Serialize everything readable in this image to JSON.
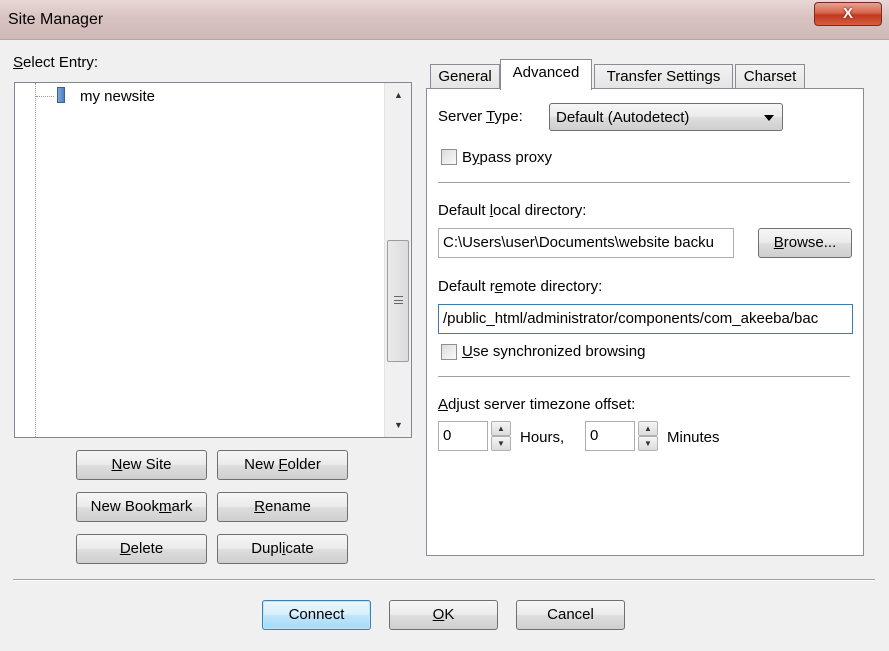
{
  "window": {
    "title": "Site Manager",
    "close_glyph": "X"
  },
  "left": {
    "select_entry_prefix": "S",
    "select_entry_rest": "elect Entry:",
    "tree_items": [
      {
        "label": "my newsite",
        "icon": "server-icon"
      }
    ]
  },
  "entry_buttons": {
    "new_site_pre": "",
    "new_site_u": "N",
    "new_site_post": "ew Site",
    "new_folder_pre": "New ",
    "new_folder_u": "F",
    "new_folder_post": "older",
    "new_bookmark_pre": "New Book",
    "new_bookmark_u": "m",
    "new_bookmark_post": "ark",
    "rename_pre": "",
    "rename_u": "R",
    "rename_post": "ename",
    "delete_pre": "",
    "delete_u": "D",
    "delete_post": "elete",
    "duplicate_pre": "Dupl",
    "duplicate_u": "i",
    "duplicate_post": "cate"
  },
  "tabs": [
    {
      "label": "General"
    },
    {
      "label": "Advanced",
      "active": true
    },
    {
      "label": "Transfer Settings"
    },
    {
      "label": "Charset"
    }
  ],
  "advanced": {
    "server_type_pre": "Server ",
    "server_type_u": "T",
    "server_type_post": "ype:",
    "server_type_value": "Default (Autodetect)",
    "bypass_pre": "B",
    "bypass_u": "y",
    "bypass_post": "pass proxy",
    "bypass_checked": false,
    "local_dir_pre": "Default ",
    "local_dir_u": "l",
    "local_dir_post": "ocal directory:",
    "local_dir_value": "C:\\Users\\user\\Documents\\website backu",
    "browse_u": "B",
    "browse_post": "rowse...",
    "remote_dir_pre": "Default r",
    "remote_dir_u": "e",
    "remote_dir_post": "mote directory:",
    "remote_dir_value": "/public_html/administrator/components/com_akeeba/bac",
    "sync_pre": "",
    "sync_u": "U",
    "sync_post": "se synchronized browsing",
    "sync_checked": false,
    "tz_pre": "",
    "tz_u": "A",
    "tz_post": "djust server timezone offset:",
    "hours_value": "0",
    "hours_label": "Hours,",
    "minutes_value": "0",
    "minutes_label": "Minutes"
  },
  "footer": {
    "connect_label": "Connect",
    "ok_u": "O",
    "ok_post": "K",
    "cancel_label": "Cancel"
  }
}
